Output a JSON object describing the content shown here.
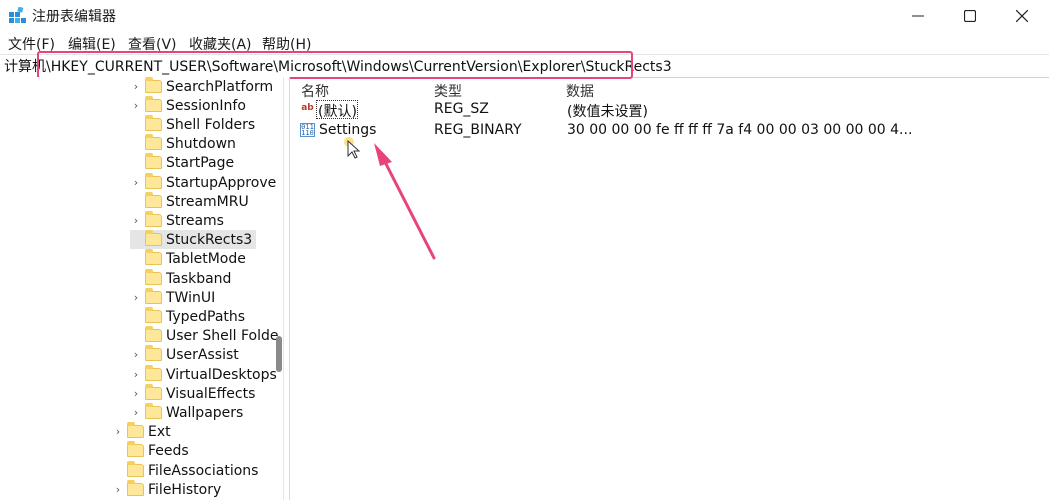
{
  "window": {
    "title": "注册表编辑器",
    "controls": {
      "minimize": "—",
      "maximize": "☐",
      "close": "✕"
    }
  },
  "menu": {
    "items": [
      "文件(F)",
      "编辑(E)",
      "查看(V)",
      "收藏夹(A)",
      "帮助(H)"
    ]
  },
  "address": {
    "path": "计算机\\HKEY_CURRENT_USER\\Software\\Microsoft\\Windows\\CurrentVersion\\Explorer\\StuckRects3"
  },
  "tree": {
    "items": [
      {
        "label": "SearchPlatform",
        "expandable": true
      },
      {
        "label": "SessionInfo",
        "expandable": true
      },
      {
        "label": "Shell Folders",
        "expandable": false
      },
      {
        "label": "Shutdown",
        "expandable": false
      },
      {
        "label": "StartPage",
        "expandable": false
      },
      {
        "label": "StartupApprove",
        "expandable": true
      },
      {
        "label": "StreamMRU",
        "expandable": false
      },
      {
        "label": "Streams",
        "expandable": true
      },
      {
        "label": "StuckRects3",
        "expandable": false,
        "selected": true
      },
      {
        "label": "TabletMode",
        "expandable": false
      },
      {
        "label": "Taskband",
        "expandable": false
      },
      {
        "label": "TWinUI",
        "expandable": true
      },
      {
        "label": "TypedPaths",
        "expandable": false
      },
      {
        "label": "User Shell Folde",
        "expandable": false
      },
      {
        "label": "UserAssist",
        "expandable": true
      },
      {
        "label": "VirtualDesktops",
        "expandable": true
      },
      {
        "label": "VisualEffects",
        "expandable": true
      },
      {
        "label": "Wallpapers",
        "expandable": true
      },
      {
        "label": "Ext",
        "expandable": true
      },
      {
        "label": "Feeds",
        "expandable": false
      },
      {
        "label": "FileAssociations",
        "expandable": false
      },
      {
        "label": "FileHistory",
        "expandable": true
      }
    ]
  },
  "list": {
    "headers": {
      "name": "名称",
      "type": "类型",
      "data": "数据"
    },
    "rows": [
      {
        "icon": "string-value-icon",
        "name": "(默认)",
        "type": "REG_SZ",
        "data": "(数值未设置)"
      },
      {
        "icon": "binary-value-icon",
        "name": "Settings",
        "type": "REG_BINARY",
        "data": "30 00 00 00 fe ff ff ff 7a f4 00 00 03 00 00 00 4..."
      }
    ]
  },
  "annotation": {
    "color": "#e6457a"
  }
}
